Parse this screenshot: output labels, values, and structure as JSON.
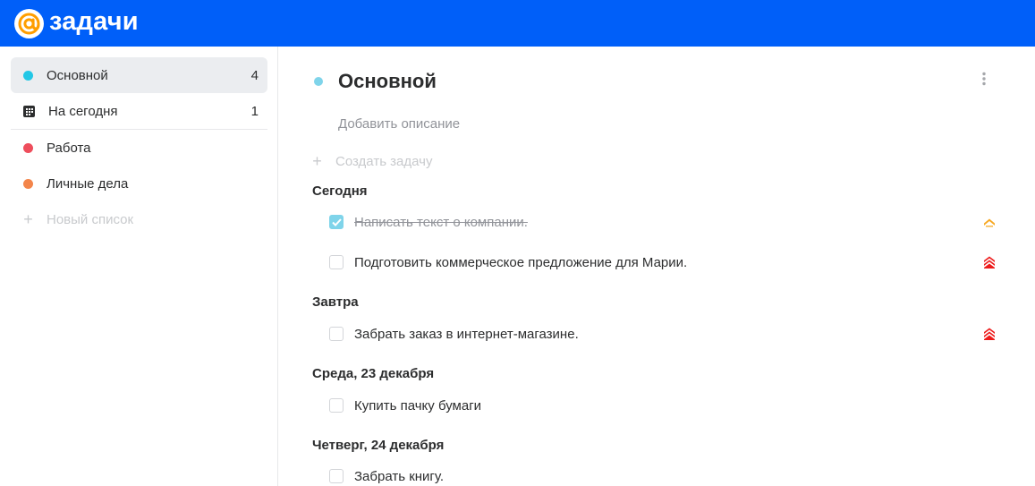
{
  "header": {
    "logo_text": "задачи",
    "logo_icon": "at-sign-logo-icon",
    "bg_color": "#005ff9"
  },
  "sidebar": {
    "items": [
      {
        "label": "Основной",
        "count": "4",
        "icon": "dot",
        "color": "#22c7e6",
        "active": true
      },
      {
        "label": "На сегодня",
        "count": "1",
        "icon": "calendar-icon",
        "color": "#2c2d2e",
        "active": false
      },
      {
        "label": "Работа",
        "count": "",
        "icon": "dot",
        "color": "#ee4e5c",
        "active": false
      },
      {
        "label": "Личные дела",
        "count": "",
        "icon": "dot",
        "color": "#f3854a",
        "active": false
      }
    ],
    "new_list_label": "Новый список"
  },
  "main": {
    "title": "Основной",
    "title_dot_color": "#7fd4ea",
    "description_placeholder": "Добавить описание",
    "create_task_label": "Создать задачу",
    "sections": [
      {
        "title": "Сегодня",
        "tasks": [
          {
            "text": "Написать текст о компании.",
            "done": true,
            "priority": "medium",
            "priority_color": "#f7a823"
          },
          {
            "text": "Подготовить коммерческое предложение для Марии.",
            "done": false,
            "priority": "high",
            "priority_color": "#ed1c1c"
          }
        ]
      },
      {
        "title": "Завтра",
        "tasks": [
          {
            "text": "Забрать заказ в интернет-магазине.",
            "done": false,
            "priority": "high",
            "priority_color": "#ed1c1c"
          }
        ]
      },
      {
        "title": "Среда, 23 декабря",
        "tasks": [
          {
            "text": "Купить пачку бумаги",
            "done": false,
            "priority": "none"
          }
        ]
      },
      {
        "title": "Четверг, 24 декабря",
        "tasks": [
          {
            "text": "Забрать книгу.",
            "done": false,
            "priority": "none"
          }
        ]
      }
    ]
  }
}
